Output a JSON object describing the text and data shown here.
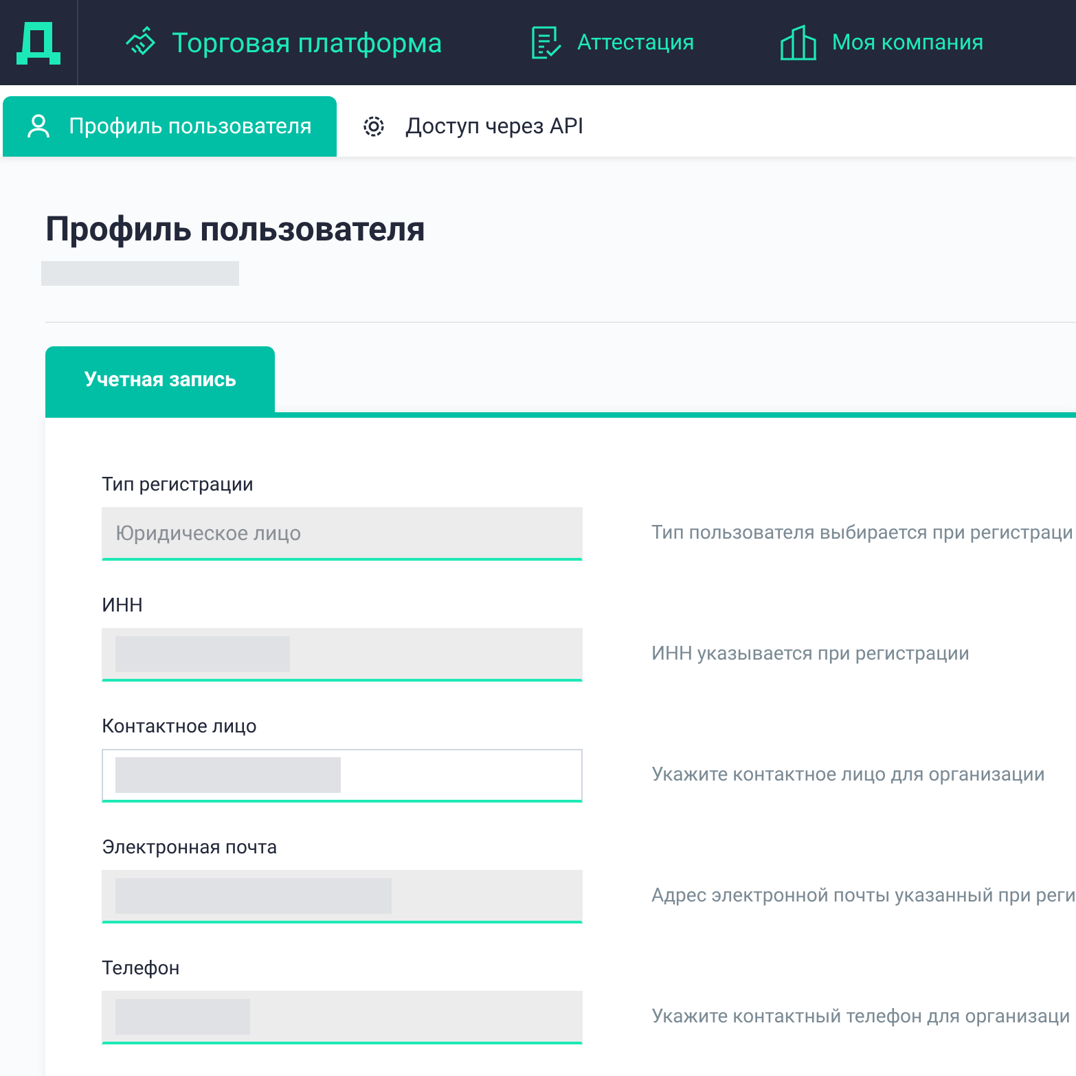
{
  "top_nav": [
    {
      "label": "Торговая платформа"
    },
    {
      "label": "Аттестация"
    },
    {
      "label": "Моя компания"
    }
  ],
  "sub_tabs": [
    {
      "label": "Профиль пользователя",
      "selected": true
    },
    {
      "label": "Доступ через API",
      "selected": false
    }
  ],
  "page": {
    "title": "Профиль пользователя"
  },
  "card_tabs": [
    {
      "label": "Учетная запись",
      "selected": true
    }
  ],
  "fields": [
    {
      "label": "Тип регистрации",
      "placeholder": "Юридическое лицо",
      "disabled": true,
      "hint": "Тип пользователя выбирается при регистраци"
    },
    {
      "label": "ИНН",
      "disabled": true,
      "hint": "ИНН указывается при регистрации"
    },
    {
      "label": "Контактное лицо",
      "disabled": false,
      "hint": "Укажите контактное лицо для организации"
    },
    {
      "label": "Электронная почта",
      "disabled": true,
      "hint": "Адрес электронной почты указанный при реги"
    },
    {
      "label": "Телефон",
      "disabled": true,
      "hint": "Укажите контактный телефон для организаци"
    }
  ]
}
